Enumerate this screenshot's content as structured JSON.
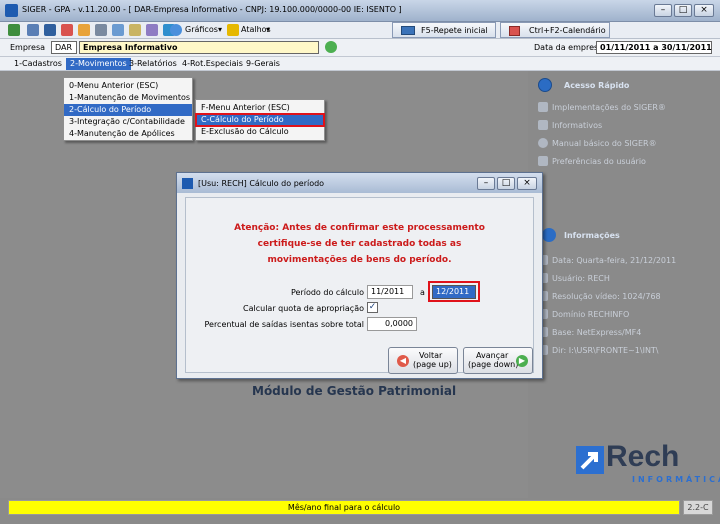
{
  "window": {
    "title": "SIGER - GPA - v.11.20.00 - [ DAR-Empresa Informativo - CNPJ: 19.100.000/0000-00 IE: ISENTO ]"
  },
  "toolbar": {
    "graficos_label": "Gráficos",
    "atalhos_label": "Atalhos"
  },
  "tabs": [
    {
      "label": "F5-Repete inicial"
    },
    {
      "label": "Ctrl+F2-Calendário"
    }
  ],
  "empresa": {
    "label": "Empresa",
    "code": "DAR",
    "name": "Empresa Informativo",
    "data_label": "Data da empresa",
    "data_value": "01/11/2011 a 30/11/2011"
  },
  "menubar": [
    "1-Cadastros",
    "2-Movimentos",
    "3-Relatórios",
    "4-Rot.Especiais",
    "9-Gerais"
  ],
  "menu_movimentos": [
    "0-Menu Anterior (ESC)",
    "1-Manutenção de Movimentos",
    "2-Cálculo do Período",
    "3-Integração c/Contabilidade",
    "4-Manutenção de Apólices"
  ],
  "submenu_calculo": [
    "F-Menu Anterior (ESC)",
    "C-Cálculo do Período",
    "E-Exclusão do Cálculo"
  ],
  "acesso_rapido": {
    "title": "Acesso Rápido",
    "links": [
      "Implementações do SIGER®",
      "Informativos",
      "Manual básico do SIGER®",
      "Preferências do usuário"
    ]
  },
  "informacoes": {
    "title": "Informações",
    "items": [
      "Data: Quarta-feira, 21/12/2011",
      "Usuário: RECH",
      "Resolução vídeo: 1024/768",
      "Domínio RECHINFO",
      "Base: NetExpress/MF4",
      "Dir: I:\\USR\\FRONTE~1\\INT\\"
    ]
  },
  "dialog": {
    "title": "[Usu: RECH] Cálculo do período",
    "warning": [
      "Atenção: Antes de confirmar este processamento",
      "certifique-se de ter cadastrado todas as",
      "movimentações de bens do período."
    ],
    "periodo_label": "Período do cálculo",
    "periodo_from": "11/2011",
    "periodo_sep": "a",
    "periodo_to": "12/2011",
    "quota_label": "Calcular quota de apropriação",
    "quota_checked": true,
    "percentual_label": "Percentual de saídas isentas sobre total",
    "percentual_value": "0,0000",
    "voltar_label": "Voltar",
    "voltar_key": "(page up)",
    "avancar_label": "Avançar",
    "avancar_key": "(page down)"
  },
  "module_title": "Módulo de Gestão Patrimonial",
  "logo": {
    "name": "Rech",
    "sub": "INFORMÁTICA"
  },
  "status": {
    "text": "Mês/ano final para o cálculo",
    "version": "2.2-C"
  },
  "colors": {
    "highlight_red": "#e0121a",
    "accent": "#316ac5",
    "warning": "#cc1b1b",
    "status_bg": "#ffff00"
  }
}
